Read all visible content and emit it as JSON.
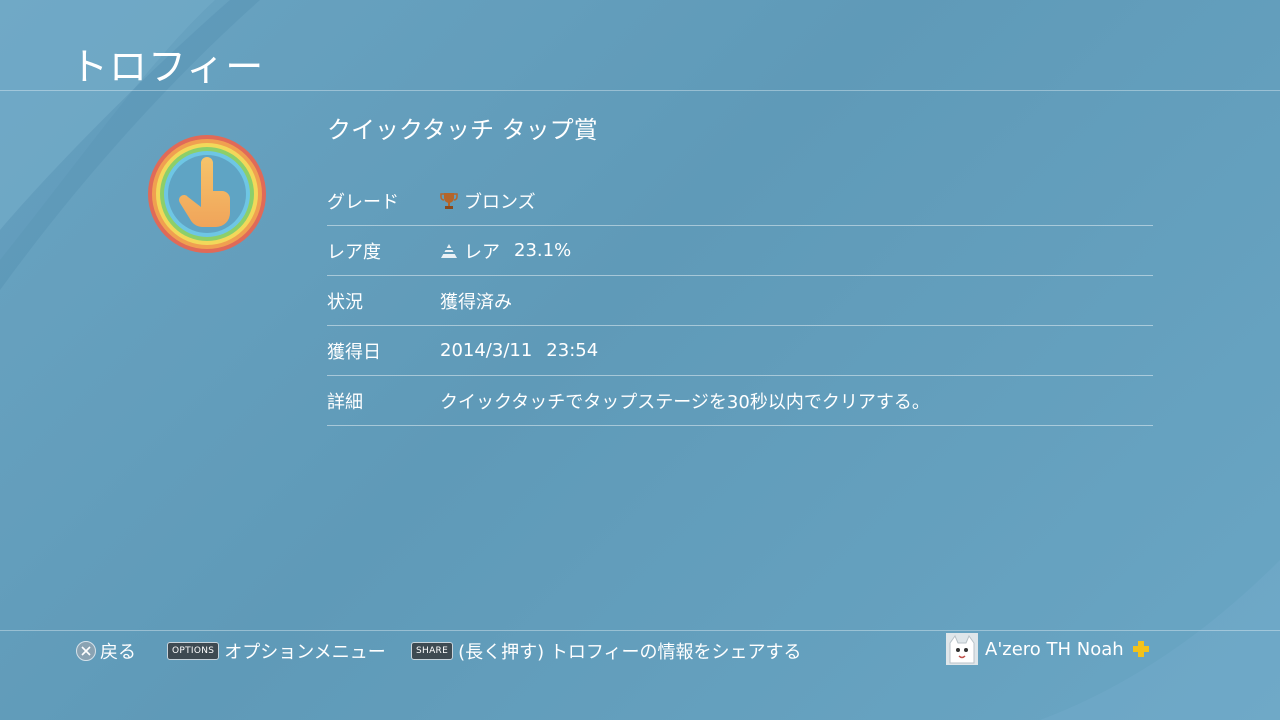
{
  "header": {
    "title": "トロフィー"
  },
  "trophy": {
    "name": "クイックタッチ タップ賞",
    "icon": "pointing-hand-rainbow-icon",
    "rows": [
      {
        "label": "グレード",
        "value": "ブロンズ",
        "icon": "bronze-trophy-icon"
      },
      {
        "label": "レア度",
        "value": "レア",
        "extra": "23.1%",
        "icon": "rarity-pyramid-icon"
      },
      {
        "label": "状況",
        "value": "獲得済み"
      },
      {
        "label": "獲得日",
        "value": "2014/3/11",
        "extra": "23:54"
      },
      {
        "label": "詳細",
        "value": "クイックタッチでタップステージを30秒以内でクリアする。"
      }
    ]
  },
  "footer": {
    "back": {
      "label": "戻る",
      "icon": "cross-button-icon"
    },
    "options": {
      "key": "OPTIONS",
      "label": "オプションメニュー"
    },
    "share": {
      "key": "SHARE",
      "label": "(長く押す) トロフィーの情報をシェアする"
    },
    "user": {
      "name": "A'zero TH Noah",
      "avatar": "toro-cat-avatar",
      "badge": "playstation-plus-icon"
    }
  },
  "colors": {
    "background": "#6aa4c2",
    "bronze": "#b5652a",
    "plus": "#f2c21a"
  }
}
